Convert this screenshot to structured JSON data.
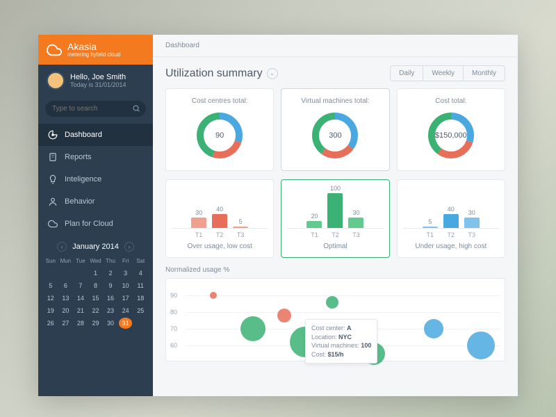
{
  "brand": {
    "name": "Akasia",
    "tagline": "metering hybrid cloud"
  },
  "user": {
    "greeting": "Hello, Joe Smith",
    "date": "Today is 31/01/2014"
  },
  "search": {
    "placeholder": "Type to search"
  },
  "nav": {
    "items": [
      {
        "label": "Dashboard",
        "icon": "gauge-icon",
        "active": true
      },
      {
        "label": "Reports",
        "icon": "document-icon"
      },
      {
        "label": "Inteligence",
        "icon": "bulb-icon"
      },
      {
        "label": "Behavior",
        "icon": "person-icon"
      },
      {
        "label": "Plan for Cloud",
        "icon": "cloud-icon"
      }
    ]
  },
  "calendar": {
    "title": "January 2014",
    "days_header": [
      "Sun",
      "Mun",
      "Tue",
      "Wed",
      "Thu",
      "Fri",
      "Sat"
    ],
    "leading_muted": [
      " ",
      " ",
      " ",
      "1",
      "2",
      "3",
      "4"
    ],
    "weeks": [
      [
        "5",
        "6",
        "7",
        "8",
        "9",
        "10",
        "11"
      ],
      [
        "12",
        "",
        "",
        "",
        "",
        "",
        ""
      ],
      [
        "13",
        "14",
        "15",
        "16",
        "17",
        "18",
        "19"
      ],
      [
        "20",
        "21",
        "22",
        "",
        "",
        "",
        ""
      ],
      [
        "26",
        "27",
        "28",
        "29",
        "30",
        "31",
        " "
      ]
    ],
    "today": "31"
  },
  "breadcrumb": "Dashboard",
  "page_title": "Utilization summary",
  "period": {
    "options": [
      "Daily",
      "Weekly",
      "Monthly"
    ]
  },
  "donuts": [
    {
      "title": "Cost centres total:",
      "value": "90"
    },
    {
      "title": "Virtual machines total:",
      "value": "300"
    },
    {
      "title": "Cost total:",
      "value": "$150,000"
    }
  ],
  "bar_groups": [
    {
      "caption": "Over usage, low cost",
      "color1": "#e76f5a",
      "color2": "#f0a08f",
      "bars": [
        {
          "label": "T1",
          "v": 30
        },
        {
          "label": "T2",
          "v": 40
        },
        {
          "label": "T3",
          "v": 5
        }
      ]
    },
    {
      "caption": "Optimal",
      "highlight": true,
      "color1": "#3bb273",
      "color2": "#62c98f",
      "bars": [
        {
          "label": "T1",
          "v": 20
        },
        {
          "label": "T2",
          "v": 100
        },
        {
          "label": "T3",
          "v": 30
        }
      ]
    },
    {
      "caption": "Under usage, high cost",
      "color1": "#4aa8e0",
      "color2": "#7fc3ea",
      "bars": [
        {
          "label": "T1",
          "v": 5
        },
        {
          "label": "T2",
          "v": 40
        },
        {
          "label": "T3",
          "v": 30
        }
      ]
    }
  ],
  "bubble": {
    "title": "Normalized usage %",
    "y_ticks": [
      90,
      80,
      70,
      60
    ],
    "tooltip": {
      "lines": [
        "Cost center:",
        "A",
        "Location:",
        "NYC",
        "Virtual machines:",
        "100",
        "Cost:",
        "$15/h"
      ]
    }
  },
  "chart_data": {
    "donuts": [
      {
        "name": "Cost centres total",
        "value": 90,
        "segments": [
          {
            "color": "#4aa8e0",
            "pct": 30
          },
          {
            "color": "#e76f5a",
            "pct": 25
          },
          {
            "color": "#3bb273",
            "pct": 45
          }
        ]
      },
      {
        "name": "Virtual machines total",
        "value": 300,
        "segments": [
          {
            "color": "#4aa8e0",
            "pct": 35
          },
          {
            "color": "#e76f5a",
            "pct": 25
          },
          {
            "color": "#3bb273",
            "pct": 40
          }
        ]
      },
      {
        "name": "Cost total",
        "value": 150000,
        "segments": [
          {
            "color": "#4aa8e0",
            "pct": 30
          },
          {
            "color": "#e76f5a",
            "pct": 30
          },
          {
            "color": "#3bb273",
            "pct": 40
          }
        ]
      }
    ],
    "bar_groups": [
      {
        "type": "bar",
        "title": "Over usage, low cost",
        "categories": [
          "T1",
          "T2",
          "T3"
        ],
        "values": [
          30,
          40,
          5
        ],
        "ylim": [
          0,
          100
        ]
      },
      {
        "type": "bar",
        "title": "Optimal",
        "categories": [
          "T1",
          "T2",
          "T3"
        ],
        "values": [
          20,
          100,
          30
        ],
        "ylim": [
          0,
          100
        ]
      },
      {
        "type": "bar",
        "title": "Under usage, high cost",
        "categories": [
          "T1",
          "T2",
          "T3"
        ],
        "values": [
          5,
          40,
          30
        ],
        "ylim": [
          0,
          100
        ]
      }
    ],
    "bubble": {
      "type": "scatter",
      "title": "Normalized usage %",
      "ylabel": "Normalized usage %",
      "ylim": [
        50,
        100
      ],
      "points": [
        {
          "x": 8,
          "y": 90,
          "r": 5,
          "color": "#e76f5a"
        },
        {
          "x": 18,
          "y": 70,
          "r": 18,
          "color": "#3bb273"
        },
        {
          "x": 30,
          "y": 78,
          "r": 10,
          "color": "#e76f5a"
        },
        {
          "x": 34,
          "y": 62,
          "r": 22,
          "color": "#3bb273"
        },
        {
          "x": 46,
          "y": 86,
          "r": 9,
          "color": "#3bb273"
        },
        {
          "x": 58,
          "y": 55,
          "r": 16,
          "color": "#3bb273"
        },
        {
          "x": 78,
          "y": 70,
          "r": 14,
          "color": "#4aa8e0"
        },
        {
          "x": 92,
          "y": 60,
          "r": 20,
          "color": "#4aa8e0"
        }
      ]
    }
  },
  "colors": {
    "orange": "#f37a1f",
    "sidebar": "#2c3e50",
    "green": "#3bb273",
    "blue": "#4aa8e0",
    "red": "#e76f5a"
  }
}
